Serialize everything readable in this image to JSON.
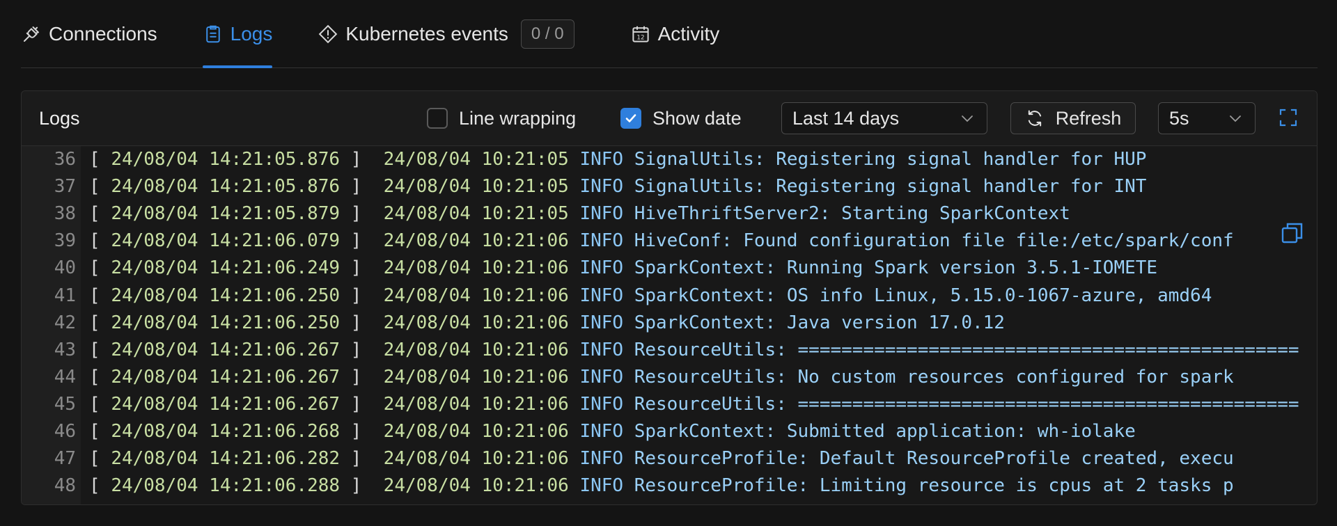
{
  "tabs": [
    {
      "label": "Connections",
      "icon": "plug-icon"
    },
    {
      "label": "Logs",
      "icon": "clipboard-icon",
      "active": true
    },
    {
      "label": "Kubernetes events",
      "icon": "diamond-alert-icon",
      "badge": "0 / 0"
    },
    {
      "label": "Activity",
      "icon": "calendar-icon"
    }
  ],
  "logs_panel": {
    "title": "Logs",
    "line_wrapping_label": "Line wrapping",
    "line_wrapping_checked": false,
    "show_date_label": "Show date",
    "show_date_checked": true,
    "date_range_value": "Last 14 days",
    "refresh_label": "Refresh",
    "interval_value": "5s"
  },
  "accent_color": "#2f7fdd",
  "log_lines": [
    {
      "n": "36",
      "ts": "24/08/04 14:21:05.876",
      "time": "24/08/04 10:21:05",
      "level": "INFO",
      "msg": "SignalUtils: Registering signal handler for HUP"
    },
    {
      "n": "37",
      "ts": "24/08/04 14:21:05.876",
      "time": "24/08/04 10:21:05",
      "level": "INFO",
      "msg": "SignalUtils: Registering signal handler for INT"
    },
    {
      "n": "38",
      "ts": "24/08/04 14:21:05.879",
      "time": "24/08/04 10:21:05",
      "level": "INFO",
      "msg": "HiveThriftServer2: Starting SparkContext"
    },
    {
      "n": "39",
      "ts": "24/08/04 14:21:06.079",
      "time": "24/08/04 10:21:06",
      "level": "INFO",
      "msg": "HiveConf: Found configuration file file:/etc/spark/conf"
    },
    {
      "n": "40",
      "ts": "24/08/04 14:21:06.249",
      "time": "24/08/04 10:21:06",
      "level": "INFO",
      "msg": "SparkContext: Running Spark version 3.5.1-IOMETE"
    },
    {
      "n": "41",
      "ts": "24/08/04 14:21:06.250",
      "time": "24/08/04 10:21:06",
      "level": "INFO",
      "msg": "SparkContext: OS info Linux, 5.15.0-1067-azure, amd64"
    },
    {
      "n": "42",
      "ts": "24/08/04 14:21:06.250",
      "time": "24/08/04 10:21:06",
      "level": "INFO",
      "msg": "SparkContext: Java version 17.0.12"
    },
    {
      "n": "43",
      "ts": "24/08/04 14:21:06.267",
      "time": "24/08/04 10:21:06",
      "level": "INFO",
      "msg": "ResourceUtils: =============================================="
    },
    {
      "n": "44",
      "ts": "24/08/04 14:21:06.267",
      "time": "24/08/04 10:21:06",
      "level": "INFO",
      "msg": "ResourceUtils: No custom resources configured for spark"
    },
    {
      "n": "45",
      "ts": "24/08/04 14:21:06.267",
      "time": "24/08/04 10:21:06",
      "level": "INFO",
      "msg": "ResourceUtils: =============================================="
    },
    {
      "n": "46",
      "ts": "24/08/04 14:21:06.268",
      "time": "24/08/04 10:21:06",
      "level": "INFO",
      "msg": "SparkContext: Submitted application: wh-iolake"
    },
    {
      "n": "47",
      "ts": "24/08/04 14:21:06.282",
      "time": "24/08/04 10:21:06",
      "level": "INFO",
      "msg": "ResourceProfile: Default ResourceProfile created, execu"
    },
    {
      "n": "48",
      "ts": "24/08/04 14:21:06.288",
      "time": "24/08/04 10:21:06",
      "level": "INFO",
      "msg": "ResourceProfile: Limiting resource is cpus at 2 tasks p"
    }
  ]
}
